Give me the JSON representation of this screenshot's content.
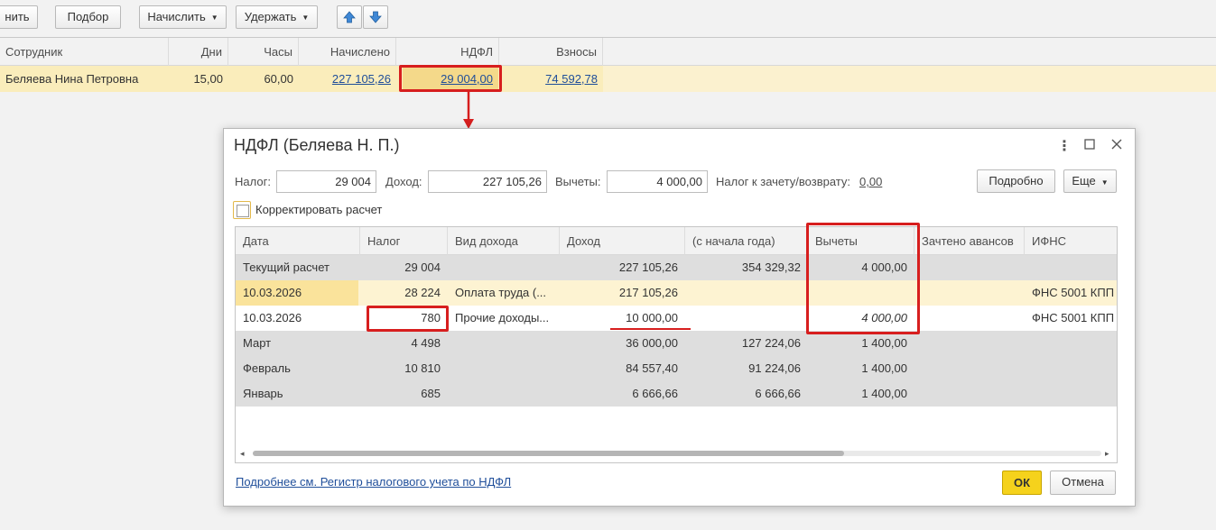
{
  "toolbar": {
    "fill_label": "нить",
    "select_label": "Подбор",
    "accrue_label": "Начислить",
    "withhold_label": "Удержать"
  },
  "main_grid": {
    "columns": [
      "Сотрудник",
      "Дни",
      "Часы",
      "Начислено",
      "НДФЛ",
      "Взносы"
    ],
    "row": {
      "employee": "Беляева Нина Петровна",
      "days": "15,00",
      "hours": "60,00",
      "accrued": "227 105,26",
      "ndfl": "29 004,00",
      "contributions": "74 592,78"
    }
  },
  "dialog": {
    "title": "НДФЛ (Беляева Н. П.)",
    "tax_label": "Налог:",
    "tax_value": "29 004",
    "income_label": "Доход:",
    "income_value": "227 105,26",
    "deductions_label": "Вычеты:",
    "deductions_value": "4 000,00",
    "offset_label": "Налог к зачету/возврату:",
    "offset_value": "0,00",
    "details_button": "Подробно",
    "more_button": "Еще",
    "correct_label": "Корректировать расчет",
    "columns": [
      "Дата",
      "Налог",
      "Вид дохода",
      "Доход",
      "(с начала года)",
      "Вычеты",
      "Зачтено авансов",
      "ИФНС"
    ],
    "rows": [
      {
        "date": "Текущий расчет",
        "tax": "29 004",
        "kind": "",
        "income": "227 105,26",
        "ytd": "354 329,32",
        "deductions": "4 000,00",
        "advances": "",
        "ifns": ""
      },
      {
        "date": "10.03.2026",
        "tax": "28 224",
        "kind": "Оплата труда (...",
        "income": "217 105,26",
        "ytd": "",
        "deductions": "",
        "advances": "",
        "ifns": "ФНС 5001 КПП"
      },
      {
        "date": "10.03.2026",
        "tax": "780",
        "kind": "Прочие доходы...",
        "income": "10 000,00",
        "ytd": "",
        "deductions": "4 000,00",
        "advances": "",
        "ifns": "ФНС 5001 КПП"
      },
      {
        "date": "Март",
        "tax": "4 498",
        "kind": "",
        "income": "36 000,00",
        "ytd": "127 224,06",
        "deductions": "1 400,00",
        "advances": "",
        "ifns": ""
      },
      {
        "date": "Февраль",
        "tax": "10 810",
        "kind": "",
        "income": "84 557,40",
        "ytd": "91 224,06",
        "deductions": "1 400,00",
        "advances": "",
        "ifns": ""
      },
      {
        "date": "Январь",
        "tax": "685",
        "kind": "",
        "income": "6 666,66",
        "ytd": "6 666,66",
        "deductions": "1 400,00",
        "advances": "",
        "ifns": ""
      }
    ],
    "footer_link": "Подробнее см. Регистр налогового учета по НДФЛ",
    "ok_button": "ОК",
    "cancel_button": "Отмена"
  },
  "colors": {
    "accent_yellow": "#f5d21c",
    "selection": "#faedbb",
    "highlight_red": "#d71e1e",
    "link": "#1f4e9a"
  },
  "icons": [
    "caret-down-icon",
    "arrow-up-icon",
    "arrow-down-icon",
    "more-icon",
    "maximize-icon",
    "close-icon",
    "checkbox-icon"
  ]
}
